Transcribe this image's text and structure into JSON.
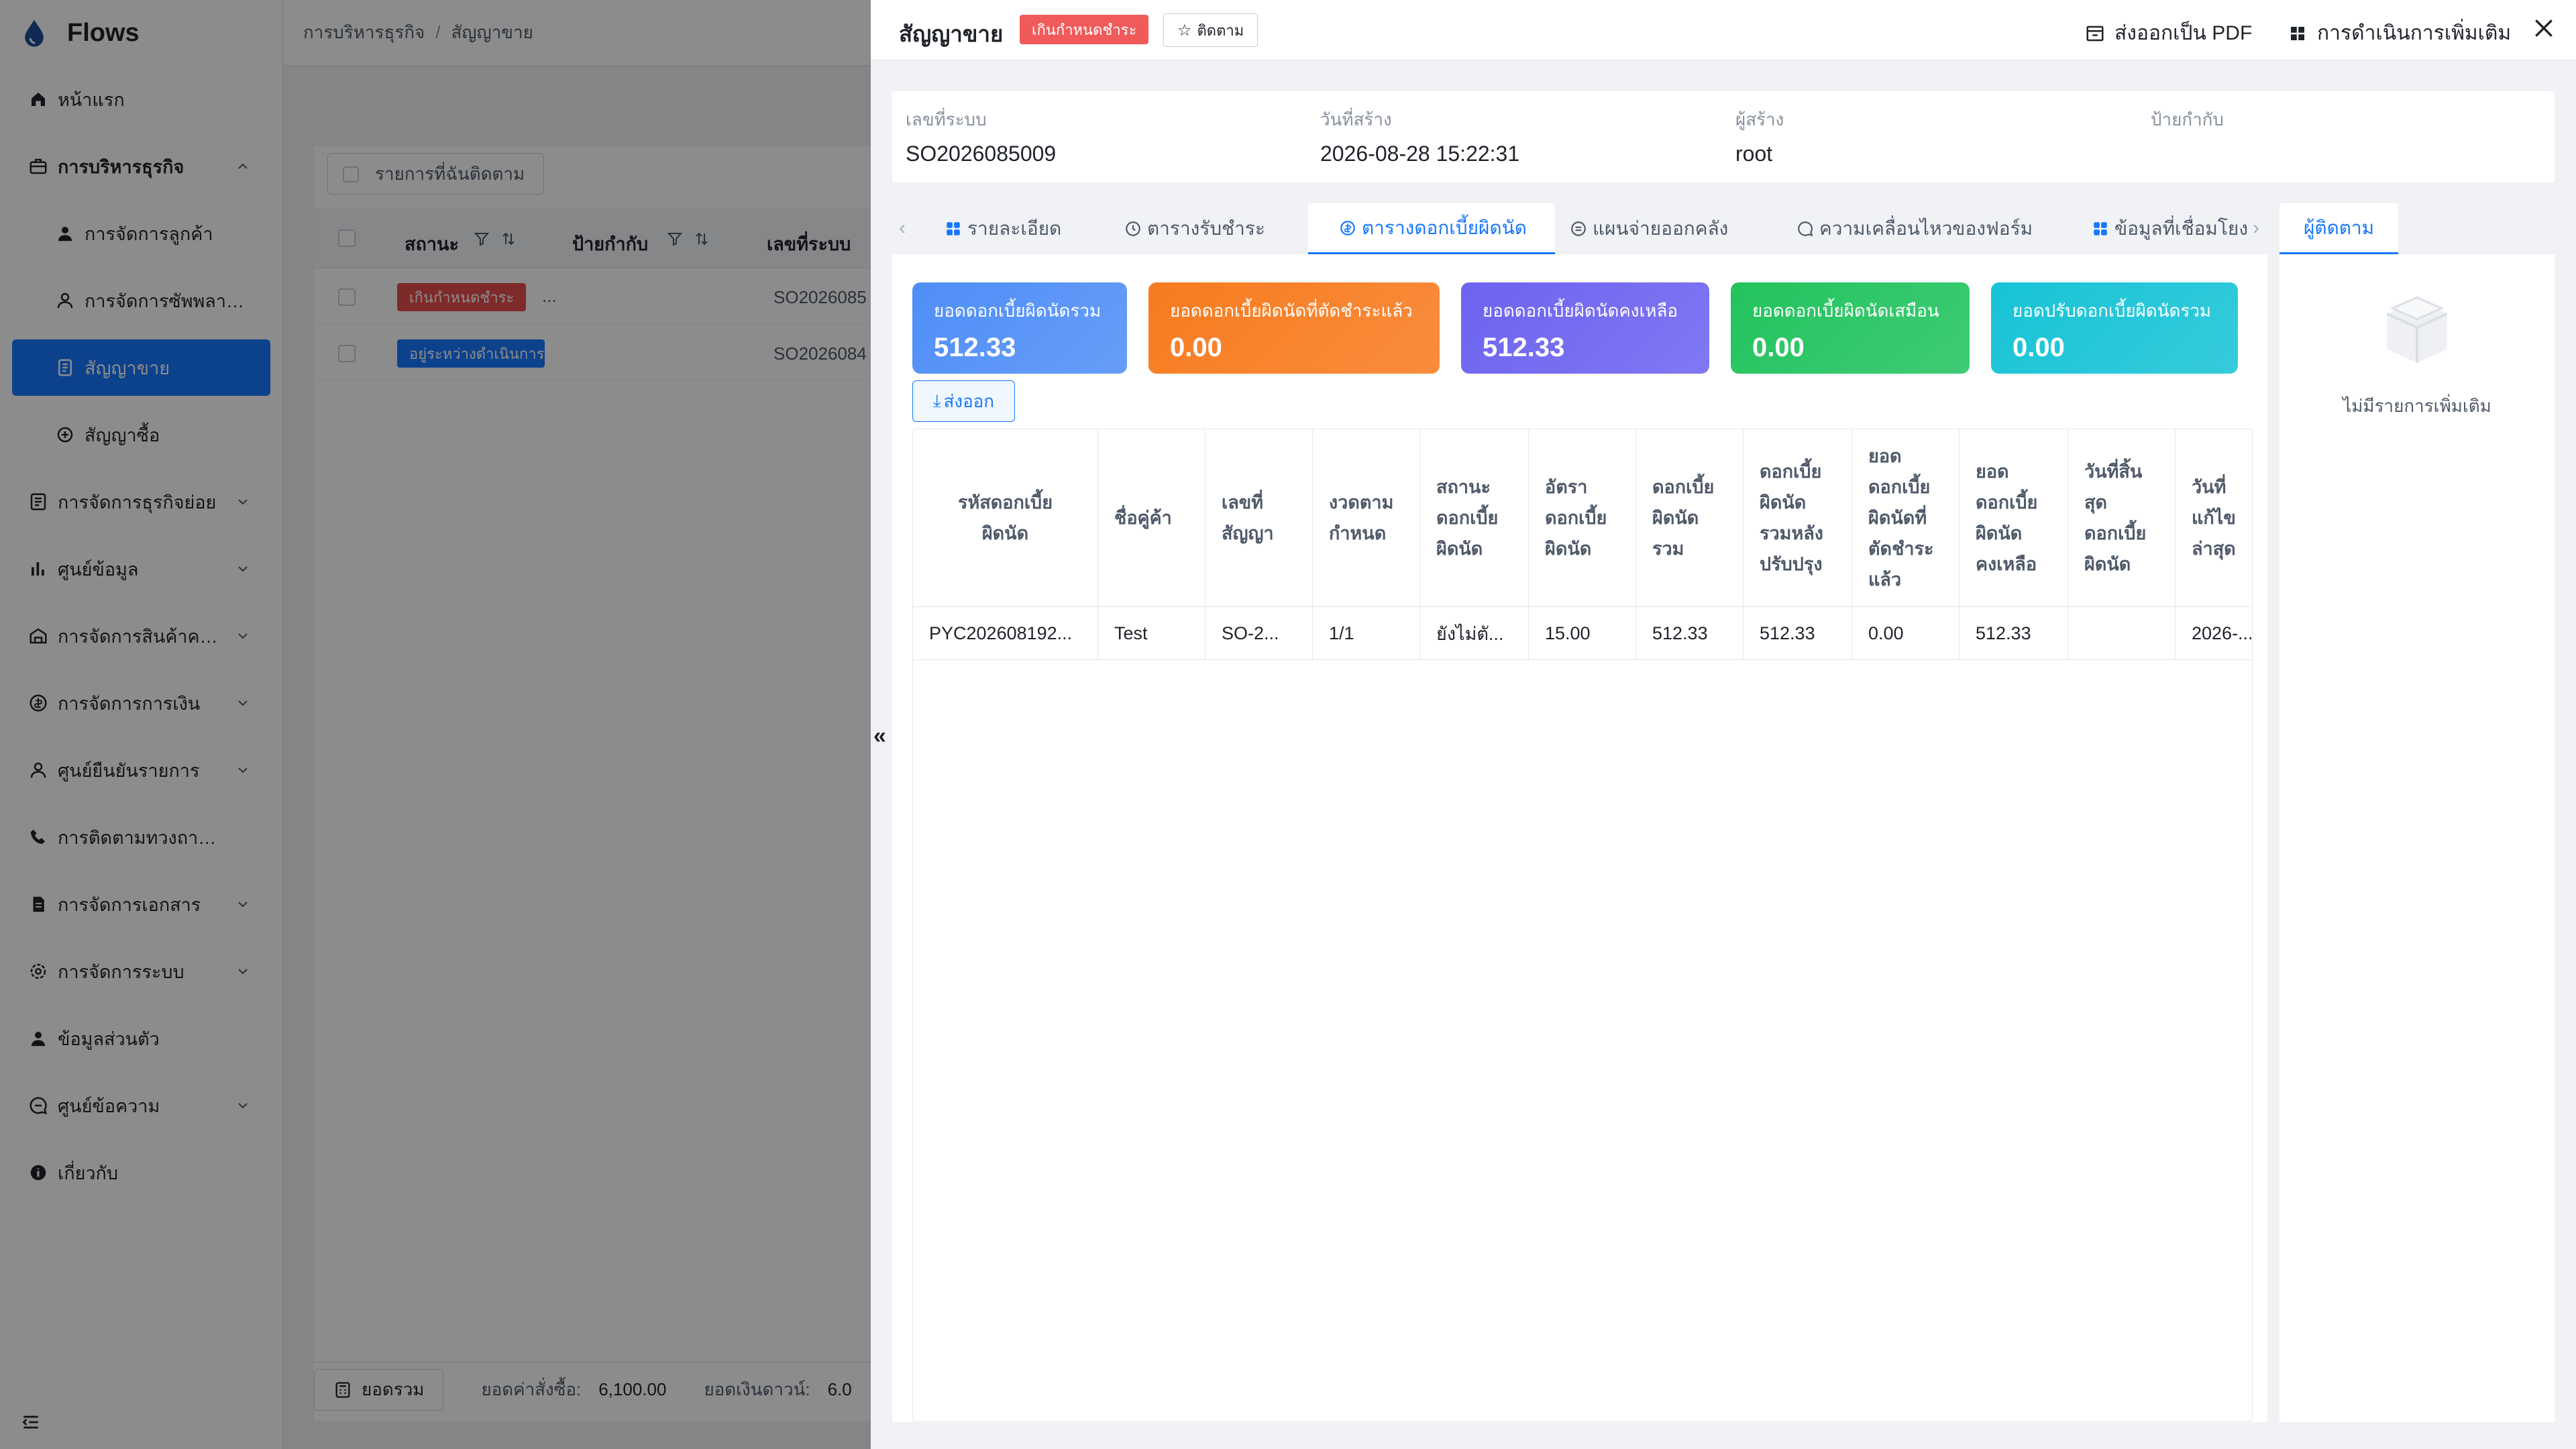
{
  "app": {
    "name": "Flows"
  },
  "sidebar": {
    "items": [
      {
        "label": "หน้าแรก",
        "icon": "home-icon"
      },
      {
        "label": "การบริหารธุรกิจ",
        "icon": "briefcase-icon",
        "open": true
      },
      {
        "label": "การจัดการลูกค้า",
        "icon": "user-icon",
        "sub": true
      },
      {
        "label": "การจัดการซัพพลายเออร์",
        "icon": "supplier-icon",
        "sub": true
      },
      {
        "label": "สัญญาขาย",
        "icon": "contract-icon",
        "sub": true,
        "active": true
      },
      {
        "label": "สัญญาซื้อ",
        "icon": "purchase-icon",
        "sub": true
      },
      {
        "label": "การจัดการธุรกิจย่อย",
        "icon": "subbusiness-icon"
      },
      {
        "label": "ศูนย์ข้อมูล",
        "icon": "chart-icon"
      },
      {
        "label": "การจัดการสินค้าคงคลัง",
        "icon": "warehouse-icon"
      },
      {
        "label": "การจัดการการเงิน",
        "icon": "finance-icon"
      },
      {
        "label": "ศูนย์ยืนยันรายการ",
        "icon": "verify-icon"
      },
      {
        "label": "การติดตามทวงถามหนี้",
        "icon": "phone-icon"
      },
      {
        "label": "การจัดการเอกสาร",
        "icon": "document-icon"
      },
      {
        "label": "การจัดการระบบ",
        "icon": "settings-icon"
      },
      {
        "label": "ข้อมูลส่วนตัว",
        "icon": "profile-icon"
      },
      {
        "label": "ศูนย์ข้อความ",
        "icon": "message-icon"
      },
      {
        "label": "เกี่ยวกับ",
        "icon": "info-icon"
      }
    ]
  },
  "breadcrumb": {
    "root": "การบริหารธุรกิจ",
    "current": "สัญญาขาย"
  },
  "list": {
    "follow_filter": "รายการที่ฉันติดตาม",
    "headers": {
      "status": "สถานะ",
      "tag": "ป้ายกำกับ",
      "system_no": "เลขที่ระบบ"
    },
    "rows": [
      {
        "status": "เกินกำหนดชำระ",
        "status_color": "#e84d4d",
        "tag": "...",
        "system_no": "SO2026085"
      },
      {
        "status": "อยู่ระหว่างดำเนินการ",
        "status_color": "#1677ff",
        "tag": "",
        "system_no": "SO2026084"
      }
    ],
    "footer": {
      "sum_button": "ยอดรวม",
      "order_label": "ยอดค่าสั่งซื้อ:",
      "order_value": "6,100.00",
      "down_label": "ยอดเงินดาวน์:",
      "down_value": "6.0"
    }
  },
  "drawer": {
    "title": "สัญญาขาย",
    "badge": "เกินกำหนดชำระ",
    "follow_label": "ติดตาม",
    "export_pdf": "ส่งออกเป็น PDF",
    "more_actions": "การดำเนินการเพิ่มเติม",
    "info": [
      {
        "label": "เลขที่ระบบ",
        "value": "SO2026085009"
      },
      {
        "label": "วันที่สร้าง",
        "value": "2026-08-28 15:22:31"
      },
      {
        "label": "ผู้สร้าง",
        "value": "root"
      },
      {
        "label": "ป้ายกำกับ",
        "value": ""
      }
    ],
    "tabs": [
      "รายละเอียด",
      "ตารางรับชำระ",
      "ตารางดอกเบี้ยผิดนัด",
      "แผนจ่ายออกคลัง",
      "ความเคลื่อนไหวของฟอร์ม",
      "ข้อมูลที่เชื่อมโยง"
    ],
    "active_tab": 2,
    "kpis": [
      {
        "title": "ยอดดอกเบี้ยผิดนัดรวม",
        "value": "512.33",
        "color": "#4f8ef7"
      },
      {
        "title": "ยอดดอกเบี้ยผิดนัดที่ตัดชำระแล้ว",
        "value": "0.00",
        "color": "#f77b1f"
      },
      {
        "title": "ยอดดอกเบี้ยผิดนัดคงเหลือ",
        "value": "512.33",
        "color": "#6c63f0"
      },
      {
        "title": "ยอดดอกเบี้ยผิดนัดเสมือน",
        "value": "0.00",
        "color": "#22c35e"
      },
      {
        "title": "ยอดปรับดอกเบี้ยผิดนัดรวม",
        "value": "0.00",
        "color": "#17c3d6"
      }
    ],
    "export_label": "ส่งออก",
    "table": {
      "headers": [
        "รหัสดอกเบี้ย\nผิดนัด",
        "ชื่อคู่ค้า",
        "เลขที่\nสัญญา",
        "งวดตาม\nกำหนด",
        "สถานะ\nดอกเบี้ย\nผิดนัด",
        "อัตรา\nดอกเบี้ย\nผิดนัด",
        "ดอกเบี้ย\nผิดนัด\nรวม",
        "ดอกเบี้ย\nผิดนัด\nรวมหลัง\nปรับปรุง",
        "ยอด\nดอกเบี้ย\nผิดนัดที่\nตัดชำระ\nแล้ว",
        "ยอด\nดอกเบี้ย\nผิดนัด\nคงเหลือ",
        "วันที่สิ้น\nสุด\nดอกเบี้ย\nผิดนัด",
        "วันที่\nแก้ไข\nล่าสุด"
      ],
      "rows": [
        [
          "PYC202608192...",
          "Test",
          "SO-2...",
          "1/1",
          "ยังไม่ตั...",
          "15.00",
          "512.33",
          "512.33",
          "0.00",
          "512.33",
          "",
          "2026-..."
        ]
      ]
    },
    "side_tab": "ผู้ติดตาม",
    "side_empty": "ไม่มีรายการเพิ่มเติม"
  }
}
